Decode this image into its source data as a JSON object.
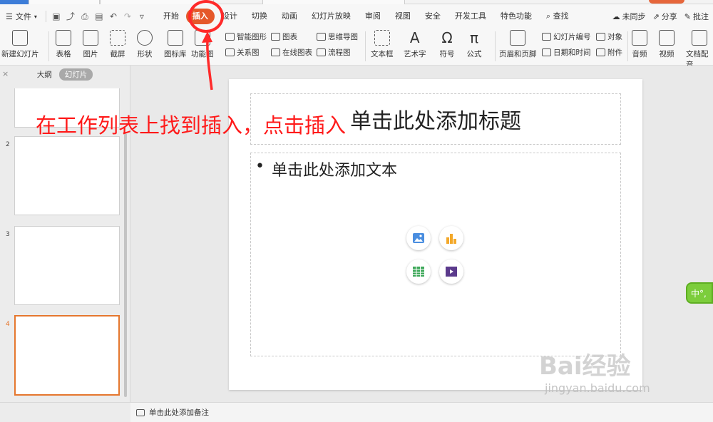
{
  "menubar": {
    "file_label": "文件",
    "tabs": [
      "开始",
      "插入",
      "设计",
      "切换",
      "动画",
      "幻灯片放映",
      "审阅",
      "视图",
      "安全",
      "开发工具",
      "特色功能"
    ],
    "active_tab": "插入",
    "search_label": "查找",
    "sync_label": "未同步",
    "share_label": "分享",
    "comment_label": "批注"
  },
  "ribbon": {
    "new_slide": "新建幻灯片",
    "table": "表格",
    "picture": "图片",
    "screenshot": "截屏",
    "shape": "形状",
    "icon_lib": "图标库",
    "functional_chart": "功能图",
    "smart_art": "智能图形",
    "chart": "图表",
    "relation_chart": "关系图",
    "online_chart": "在线图表",
    "mind_map": "思维导图",
    "flow_chart": "流程图",
    "text_box": "文本框",
    "word_art": "艺术字",
    "symbol": "符号",
    "formula": "公式",
    "header_footer": "页眉和页脚",
    "slide_number": "幻灯片编号",
    "object": "对象",
    "date_time": "日期和时间",
    "attachment": "附件",
    "audio": "音频",
    "video": "视频",
    "doc_audio": "文档配音"
  },
  "leftpane": {
    "outline_tab": "大纲",
    "slides_tab": "幻灯片",
    "slide_numbers": [
      "2",
      "3",
      "4"
    ],
    "add_slide": "+"
  },
  "slide": {
    "title_placeholder": "单击此处添加标题",
    "body_placeholder": "单击此处添加文本",
    "bullet": "•"
  },
  "notes": {
    "placeholder": "单击此处添加备注"
  },
  "annotation": {
    "text": "在工作列表上找到插入，点击插入"
  },
  "ime": {
    "label": "中°,"
  },
  "watermark": {
    "brand": "Bai经验",
    "url": "jingyan.baidu.com"
  },
  "colors": {
    "accent": "#e5582a",
    "annotation_red": "#ff2a2a",
    "selected_slide_border": "#e5772e"
  }
}
